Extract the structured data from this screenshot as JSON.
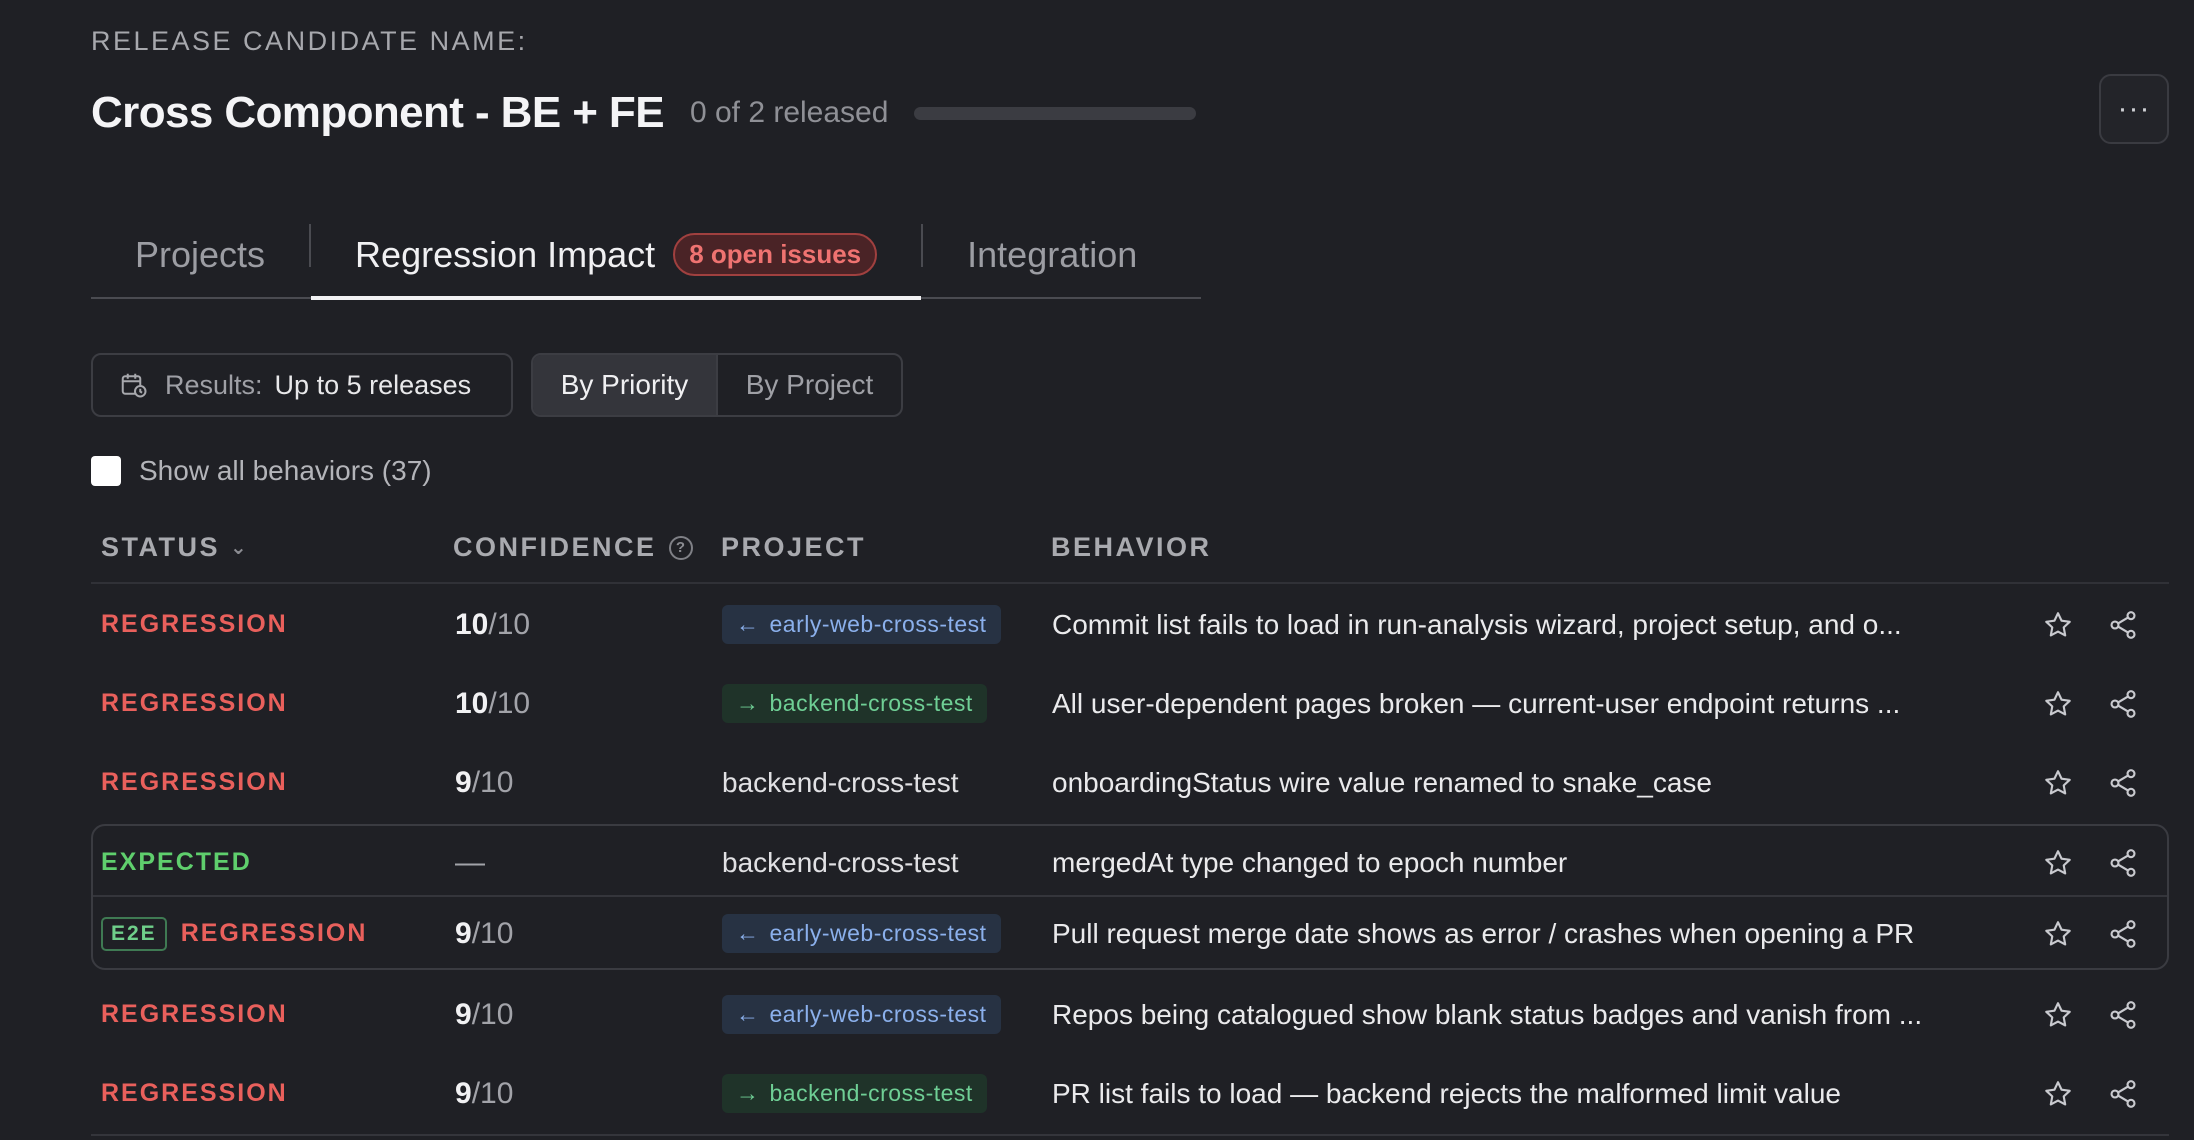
{
  "header": {
    "eyebrow": "RELEASE CANDIDATE NAME:",
    "title": "Cross Component - BE + FE",
    "released_text": "0 of 2 released",
    "released_fraction": 0,
    "more_label": "···"
  },
  "tabs": [
    {
      "label": "Projects",
      "active": false
    },
    {
      "label": "Regression Impact",
      "active": true,
      "badge": "8 open issues"
    },
    {
      "label": "Integration",
      "active": false
    }
  ],
  "filters": {
    "results_label": "Results:",
    "results_value": "Up to 5 releases",
    "sort_options": [
      {
        "label": "By Priority",
        "selected": true
      },
      {
        "label": "By Project",
        "selected": false
      }
    ],
    "show_all_label": "Show all behaviors (37)",
    "show_all_checked": false
  },
  "table": {
    "headers": {
      "status": "STATUS",
      "confidence": "CONFIDENCE",
      "project": "PROJECT",
      "behavior": "BEHAVIOR"
    },
    "rows": [
      {
        "status": "REGRESSION",
        "score": "10",
        "denom": "/10",
        "project": "early-web-cross-test",
        "project_style": "web",
        "behavior": "Commit list fails to load in run-analysis wizard, project setup, and o..."
      },
      {
        "status": "REGRESSION",
        "score": "10",
        "denom": "/10",
        "project": "backend-cross-test",
        "project_style": "be",
        "behavior": "All user-dependent pages broken — current-user endpoint returns ..."
      },
      {
        "status": "REGRESSION",
        "score": "9",
        "denom": "/10",
        "project": "backend-cross-test",
        "project_style": "plain",
        "behavior": "onboardingStatus wire value renamed to snake_case"
      },
      {
        "status": "EXPECTED",
        "score": "—",
        "denom": "",
        "project": "backend-cross-test",
        "project_style": "plain",
        "behavior": "mergedAt type changed to epoch number"
      },
      {
        "status": "REGRESSION",
        "e2e": "E2E",
        "score": "9",
        "denom": "/10",
        "project": "early-web-cross-test",
        "project_style": "web",
        "behavior": "Pull request merge date shows as error / crashes when opening a PR"
      },
      {
        "status": "REGRESSION",
        "score": "9",
        "denom": "/10",
        "project": "early-web-cross-test",
        "project_style": "web",
        "behavior": "Repos being catalogued show blank status badges and vanish from ..."
      },
      {
        "status": "REGRESSION",
        "score": "9",
        "denom": "/10",
        "project": "backend-cross-test",
        "project_style": "be",
        "behavior": "PR list fails to load — backend rejects the malformed limit value"
      }
    ]
  },
  "colors": {
    "regression": "#e9605c",
    "expected": "#5fcf6d",
    "web_tag": "#8bb0ec",
    "backend_tag": "#6fcf95"
  },
  "icons": {
    "arrow_left": "←",
    "arrow_right": "→",
    "sort_caret": "⌄",
    "help": "?"
  }
}
